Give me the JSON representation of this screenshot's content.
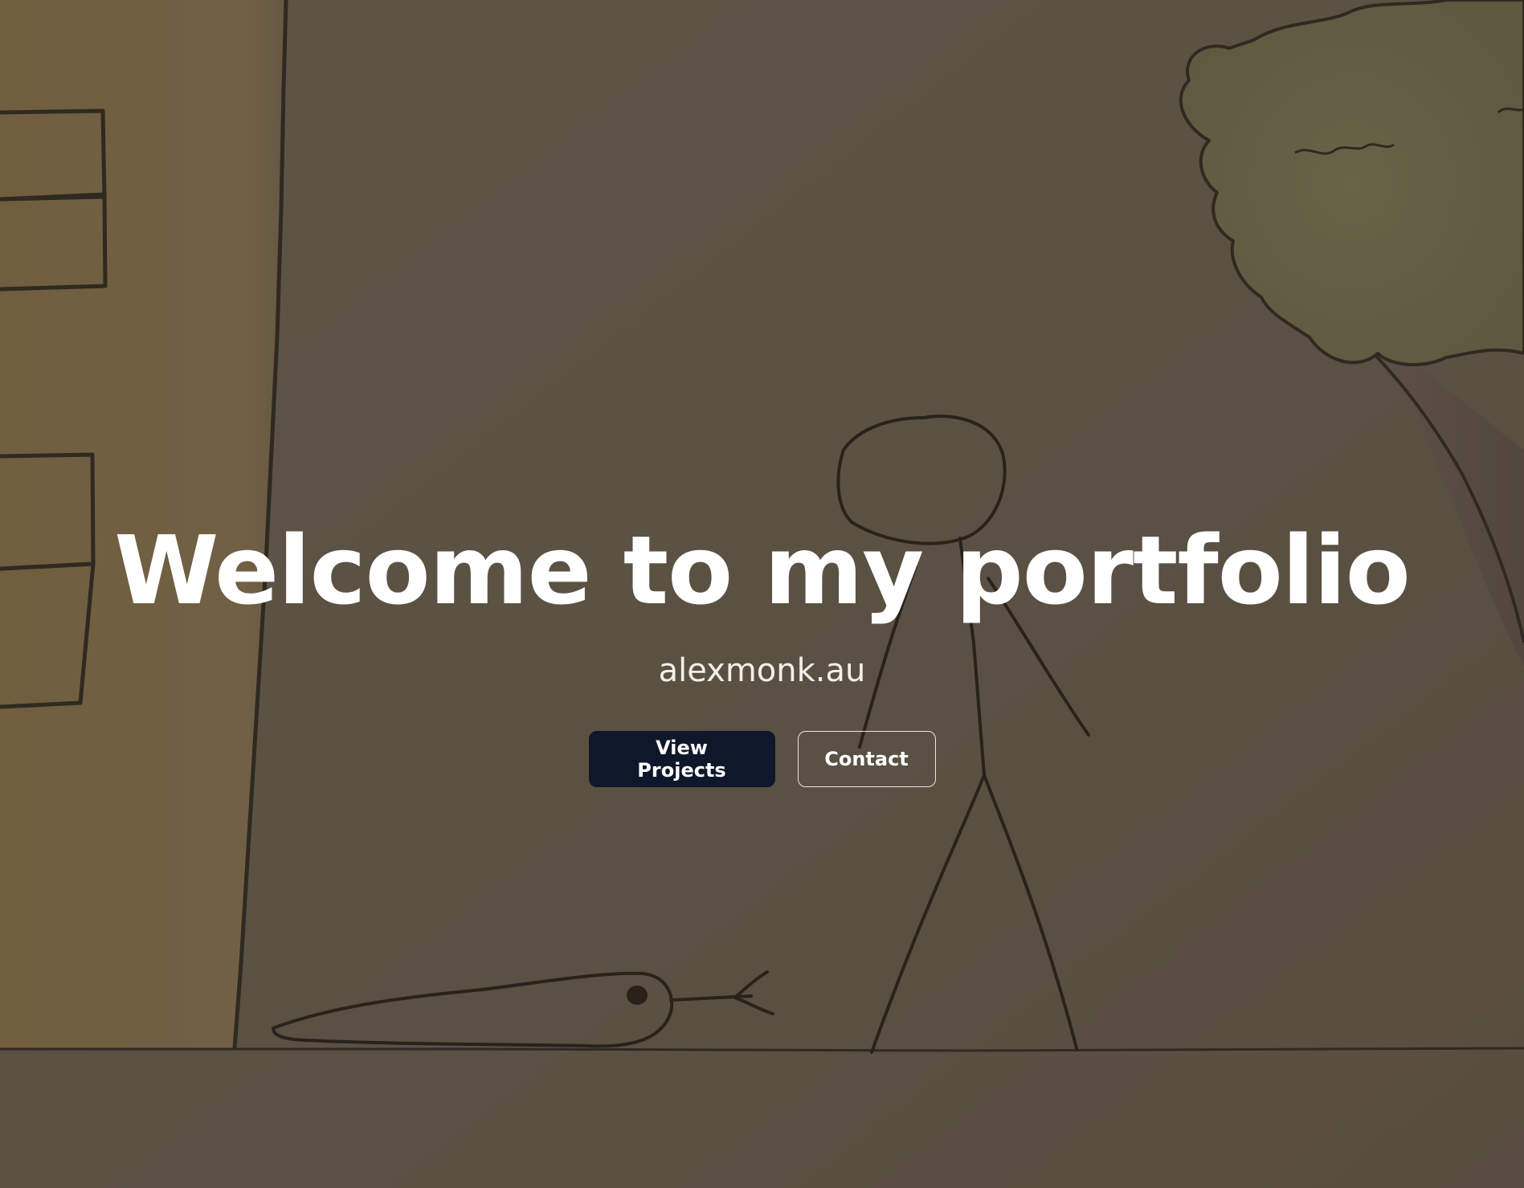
{
  "hero": {
    "title": "Welcome to my portfolio",
    "subtitle": "alexmonk.au",
    "background": "hand-drawn-sketch-stick-figure-building-tree-bird",
    "colors": {
      "overlay": "#5e5446",
      "primary_button": "#0f172a",
      "text": "#ffffff"
    }
  },
  "actions": {
    "primary_label": "View Projects",
    "secondary_label": "Contact"
  }
}
